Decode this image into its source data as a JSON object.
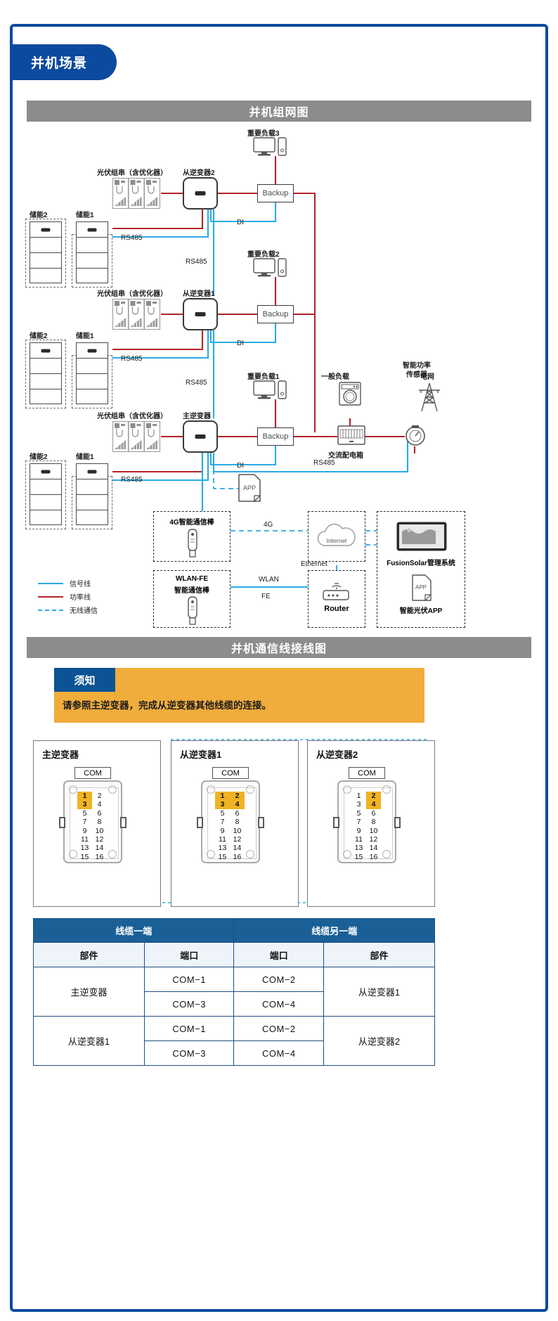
{
  "header": {
    "title": "并机场景"
  },
  "bands": {
    "network": "并机组网图",
    "wiring": "并机通信线接线图"
  },
  "network": {
    "labels": {
      "pv_string": "光伏组串（含优化器）",
      "slave_inverter_2": "从逆变器2",
      "slave_inverter_1": "从逆变器1",
      "master_inverter": "主逆变器",
      "storage_2": "储能2",
      "storage_1": "储能1",
      "rs485": "RS485",
      "di": "DI",
      "backup": "Backup",
      "critical_load_3": "重要负载3",
      "critical_load_2": "重要负载2",
      "critical_load_1": "重要负载1",
      "general_load": "一般负载",
      "smart_power_sensor": "智能功率\n传感器",
      "smart_power_sensor_l1": "智能功率",
      "smart_power_sensor_l2": "传感器",
      "grid": "电网",
      "ac_distribution_box": "交流配电箱",
      "app_doc": "APP"
    },
    "modules": {
      "dongle_4g": "4G智能通信棒",
      "dongle_wlan_fe_l1": "WLAN-FE",
      "dongle_wlan_fe_l2": "智能通信棒",
      "internet": "Internet",
      "router": "Router",
      "fusionsolar": "FusionSolar管理系统",
      "smart_pv_app": "智能光伏APP",
      "app_badge": "APP",
      "link_4g": "4G",
      "link_ethernet": "Ethernet",
      "link_wlan": "WLAN",
      "link_fe": "FE"
    },
    "legend": [
      {
        "label": "信号线",
        "color": "#29abe2",
        "style": "solid"
      },
      {
        "label": "功率线",
        "color": "#b4222c",
        "style": "solid"
      },
      {
        "label": "无线通信",
        "color": "#29abe2",
        "style": "dashed"
      }
    ]
  },
  "notice": {
    "tag": "须知",
    "text": "请参照主逆变器，完成从逆变器其他线缆的连接。"
  },
  "connectors": [
    {
      "title": "主逆变器",
      "com_label": "COM",
      "pins": [
        "1",
        "2",
        "3",
        "4",
        "5",
        "6",
        "7",
        "8",
        "9",
        "10",
        "11",
        "12",
        "13",
        "14",
        "15",
        "16"
      ],
      "highlighted": [
        "1",
        "3"
      ]
    },
    {
      "title": "从逆变器1",
      "com_label": "COM",
      "pins": [
        "1",
        "2",
        "3",
        "4",
        "5",
        "6",
        "7",
        "8",
        "9",
        "10",
        "11",
        "12",
        "13",
        "14",
        "15",
        "16"
      ],
      "highlighted": [
        "1",
        "2",
        "3",
        "4"
      ]
    },
    {
      "title": "从逆变器2",
      "com_label": "COM",
      "pins": [
        "1",
        "2",
        "3",
        "4",
        "5",
        "6",
        "7",
        "8",
        "9",
        "10",
        "11",
        "12",
        "13",
        "14",
        "15",
        "16"
      ],
      "highlighted": [
        "2",
        "4"
      ]
    }
  ],
  "table": {
    "group_headers": [
      "线缆一端",
      "线缆另一端"
    ],
    "column_headers": [
      "部件",
      "端口",
      "端口",
      "部件"
    ],
    "rows": [
      {
        "part_a": "主逆变器",
        "port_a": "COM−1",
        "port_b": "COM−2",
        "part_b": "从逆变器1"
      },
      {
        "part_a": "主逆变器",
        "port_a": "COM−3",
        "port_b": "COM−4",
        "part_b": "从逆变器1"
      },
      {
        "part_a": "从逆变器1",
        "port_a": "COM−1",
        "port_b": "COM−2",
        "part_b": "从逆变器2"
      },
      {
        "part_a": "从逆变器1",
        "port_a": "COM−3",
        "port_b": "COM−4",
        "part_b": "从逆变器2"
      }
    ]
  },
  "colors": {
    "brand_blue": "#0b4a9e",
    "band_grey": "#8c8c8c",
    "notice_amber": "#f0ad3c",
    "signal_blue": "#29abe2",
    "power_red": "#b4222c",
    "pin_highlight": "#f0b323",
    "table_header": "#1a6096"
  }
}
